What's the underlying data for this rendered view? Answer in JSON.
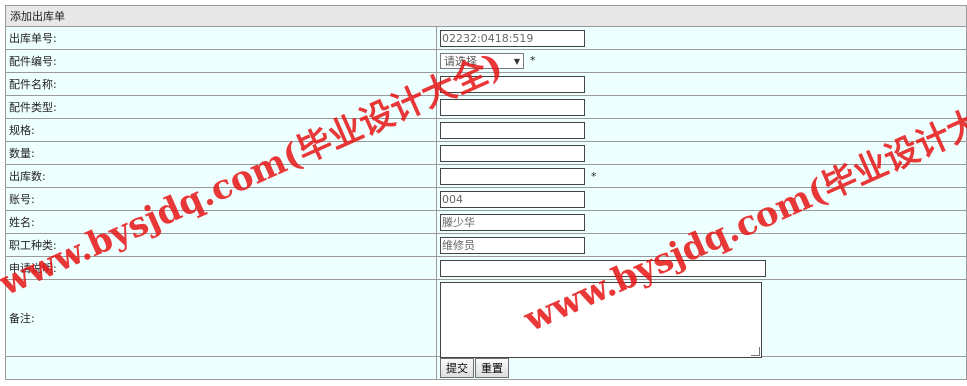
{
  "form": {
    "title": "添加出库单",
    "labels": {
      "order_no": "出库单号:",
      "part_no": "配件编号:",
      "part_name": "配件名称:",
      "part_type": "配件类型:",
      "spec": "规格:",
      "quantity": "数量:",
      "out_qty": "出库数:",
      "account": "账号:",
      "name": "姓名:",
      "job_type": "职工种类:",
      "request_desc": "申请说明:",
      "remark": "备注:"
    },
    "values": {
      "order_no": "02232:0418:519",
      "part_no_selected": "请选择",
      "part_name": "",
      "part_type": "",
      "spec": "",
      "quantity": "",
      "out_qty": "",
      "account": "004",
      "name": "滕少华",
      "job_type": "维修员",
      "request_desc": "",
      "remark": ""
    },
    "required_mark": "*",
    "buttons": {
      "submit": "提交",
      "reset": "重置"
    }
  },
  "watermark": {
    "text": "www.bysjdq.com(毕业设计大全)",
    "color": "#e61414"
  }
}
